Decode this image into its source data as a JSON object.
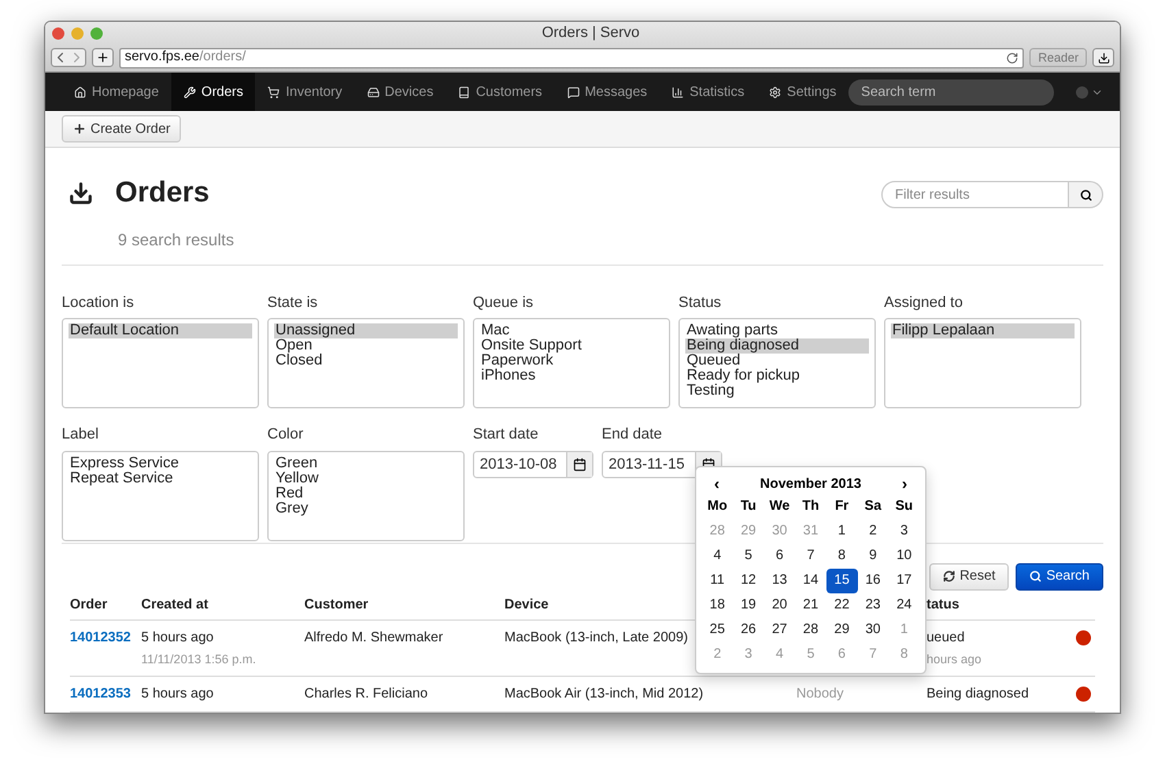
{
  "browser": {
    "title": "Orders | Servo",
    "url_host": "servo.fps.ee",
    "url_path": "/orders/",
    "reader": "Reader"
  },
  "nav": {
    "items": [
      {
        "label": "Homepage",
        "selected": false
      },
      {
        "label": "Orders",
        "selected": true
      },
      {
        "label": "Inventory",
        "selected": false
      },
      {
        "label": "Devices",
        "selected": false
      },
      {
        "label": "Customers",
        "selected": false
      },
      {
        "label": "Messages",
        "selected": false
      },
      {
        "label": "Statistics",
        "selected": false
      },
      {
        "label": "Settings",
        "selected": false
      }
    ],
    "search_placeholder": "Search term"
  },
  "toolbar": {
    "create_button": "Create Order"
  },
  "header": {
    "title": "Orders",
    "result_count": "9 search results",
    "filter_placeholder": "Filter results"
  },
  "filters": [
    {
      "label": "Location is",
      "options": [
        {
          "label": "Default Location",
          "selected": true
        }
      ]
    },
    {
      "label": "State is",
      "options": [
        {
          "label": "Unassigned",
          "selected": true
        },
        {
          "label": "Open",
          "selected": false
        },
        {
          "label": "Closed",
          "selected": false
        }
      ]
    },
    {
      "label": "Queue is",
      "options": [
        {
          "label": "Mac",
          "selected": false
        },
        {
          "label": "Onsite Support",
          "selected": false
        },
        {
          "label": "Paperwork",
          "selected": false
        },
        {
          "label": "iPhones",
          "selected": false
        }
      ]
    },
    {
      "label": "Status",
      "options": [
        {
          "label": "Awating parts",
          "selected": false
        },
        {
          "label": "Being diagnosed",
          "selected": true
        },
        {
          "label": "Queued",
          "selected": false
        },
        {
          "label": "Ready for pickup",
          "selected": false
        },
        {
          "label": "Testing",
          "selected": false
        }
      ]
    },
    {
      "label": "Assigned to",
      "options": [
        {
          "label": "Filipp Lepalaan",
          "selected": true
        }
      ]
    },
    {
      "label": "Label",
      "options": [
        {
          "label": "Express Service",
          "selected": false
        },
        {
          "label": "Repeat Service",
          "selected": false
        }
      ]
    },
    {
      "label": "Color",
      "options": [
        {
          "label": "Green",
          "selected": false
        },
        {
          "label": "Yellow",
          "selected": false
        },
        {
          "label": "Red",
          "selected": false
        },
        {
          "label": "Grey",
          "selected": false
        }
      ]
    }
  ],
  "dates": [
    {
      "label": "Start date",
      "value": "2013-10-08"
    },
    {
      "label": "End date",
      "value": "2013-11-15"
    }
  ],
  "calendar": {
    "prev": "‹",
    "next": "›",
    "month": "November 2013",
    "weekdays": [
      "Mo",
      "Tu",
      "We",
      "Th",
      "Fr",
      "Sa",
      "Su"
    ],
    "weeks": [
      [
        {
          "day": "28",
          "muted": true,
          "selected": false
        },
        {
          "day": "29",
          "muted": true,
          "selected": false
        },
        {
          "day": "30",
          "muted": true,
          "selected": false
        },
        {
          "day": "31",
          "muted": true,
          "selected": false
        },
        {
          "day": "1",
          "muted": false,
          "selected": false
        },
        {
          "day": "2",
          "muted": false,
          "selected": false
        },
        {
          "day": "3",
          "muted": false,
          "selected": false
        }
      ],
      [
        {
          "day": "4",
          "muted": false,
          "selected": false
        },
        {
          "day": "5",
          "muted": false,
          "selected": false
        },
        {
          "day": "6",
          "muted": false,
          "selected": false
        },
        {
          "day": "7",
          "muted": false,
          "selected": false
        },
        {
          "day": "8",
          "muted": false,
          "selected": false
        },
        {
          "day": "9",
          "muted": false,
          "selected": false
        },
        {
          "day": "10",
          "muted": false,
          "selected": false
        }
      ],
      [
        {
          "day": "11",
          "muted": false,
          "selected": false
        },
        {
          "day": "12",
          "muted": false,
          "selected": false
        },
        {
          "day": "13",
          "muted": false,
          "selected": false
        },
        {
          "day": "14",
          "muted": false,
          "selected": false
        },
        {
          "day": "15",
          "muted": false,
          "selected": true
        },
        {
          "day": "16",
          "muted": false,
          "selected": false
        },
        {
          "day": "17",
          "muted": false,
          "selected": false
        }
      ],
      [
        {
          "day": "18",
          "muted": false,
          "selected": false
        },
        {
          "day": "19",
          "muted": false,
          "selected": false
        },
        {
          "day": "20",
          "muted": false,
          "selected": false
        },
        {
          "day": "21",
          "muted": false,
          "selected": false
        },
        {
          "day": "22",
          "muted": false,
          "selected": false
        },
        {
          "day": "23",
          "muted": false,
          "selected": false
        },
        {
          "day": "24",
          "muted": false,
          "selected": false
        }
      ],
      [
        {
          "day": "25",
          "muted": false,
          "selected": false
        },
        {
          "day": "26",
          "muted": false,
          "selected": false
        },
        {
          "day": "27",
          "muted": false,
          "selected": false
        },
        {
          "day": "28",
          "muted": false,
          "selected": false
        },
        {
          "day": "29",
          "muted": false,
          "selected": false
        },
        {
          "day": "30",
          "muted": false,
          "selected": false
        },
        {
          "day": "1",
          "muted": true,
          "selected": false
        }
      ],
      [
        {
          "day": "2",
          "muted": true,
          "selected": false
        },
        {
          "day": "3",
          "muted": true,
          "selected": false
        },
        {
          "day": "4",
          "muted": true,
          "selected": false
        },
        {
          "day": "5",
          "muted": true,
          "selected": false
        },
        {
          "day": "6",
          "muted": true,
          "selected": false
        },
        {
          "day": "7",
          "muted": true,
          "selected": false
        },
        {
          "day": "8",
          "muted": true,
          "selected": false
        }
      ]
    ]
  },
  "actions": {
    "reset": "Reset",
    "search": "Search"
  },
  "table": {
    "columns": [
      "Order",
      "Created at",
      "Customer",
      "Device",
      "tatus"
    ],
    "rows": [
      {
        "order": "14012352",
        "created": "5 hours ago",
        "created_detail": "11/11/2013 1:56 p.m.",
        "customer": "Alfredo M. Shewmaker",
        "device": "MacBook (13-inch, Late 2009)",
        "status": "ueued",
        "status_detail": "hours ago",
        "color": "#cc2200"
      },
      {
        "order": "14012353",
        "created": "5 hours ago",
        "customer": "Charles R. Feliciano",
        "device": "MacBook Air (13-inch, Mid 2012)",
        "column_5": "Nobody",
        "status": "Being diagnosed",
        "color": "#cc2200"
      }
    ]
  }
}
